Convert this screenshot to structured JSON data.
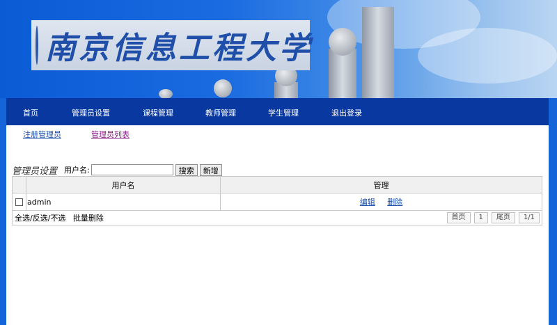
{
  "banner": {
    "title": "南京信息工程大学",
    "emblem": "nuist-emblem"
  },
  "nav": [
    "首页",
    "管理员设置",
    "课程管理",
    "教师管理",
    "学生管理",
    "退出登录"
  ],
  "subnav": {
    "register": "注册管理员",
    "list": "管理员列表"
  },
  "toolbar": {
    "section_title": "管理员设置",
    "username_label": "用户名:",
    "username_value": "",
    "search_label": "搜索",
    "add_label": "新增"
  },
  "table": {
    "headers": [
      "用户名",
      "管理"
    ],
    "rows": [
      {
        "username": "admin",
        "edit": "编辑",
        "delete": "删除"
      }
    ]
  },
  "footer": {
    "select_all": "全选",
    "invert": "反选",
    "none": "不选",
    "batch_delete": "批量删除",
    "first": "首页",
    "page": "1",
    "last": "尾页",
    "pages": "1/1"
  },
  "colors": {
    "page_bg": "#1565d8",
    "navbar": "#0838a0",
    "link": "#1a4fb0",
    "visited_link": "#8a1a8a"
  }
}
